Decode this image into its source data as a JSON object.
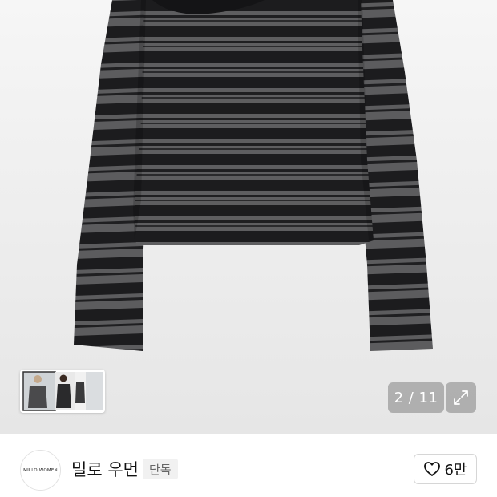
{
  "gallery": {
    "current_page": "2",
    "total_pages": "11",
    "counter_text": "2 / 11",
    "thumbnail_count": 3
  },
  "icons": {
    "thumb_next": "chevron-right-icon",
    "expand": "expand-arrows-icon",
    "like": "heart-outline-icon"
  },
  "store": {
    "logo_text": "MILLO WOMEN",
    "name": "밀로 우먼",
    "badge": "단독"
  },
  "like": {
    "count": "6만"
  },
  "colors": {
    "stripe_dark": "#1c1c1e",
    "stripe_grey": "#5e5e60",
    "overlay": "#8a8a8a"
  }
}
